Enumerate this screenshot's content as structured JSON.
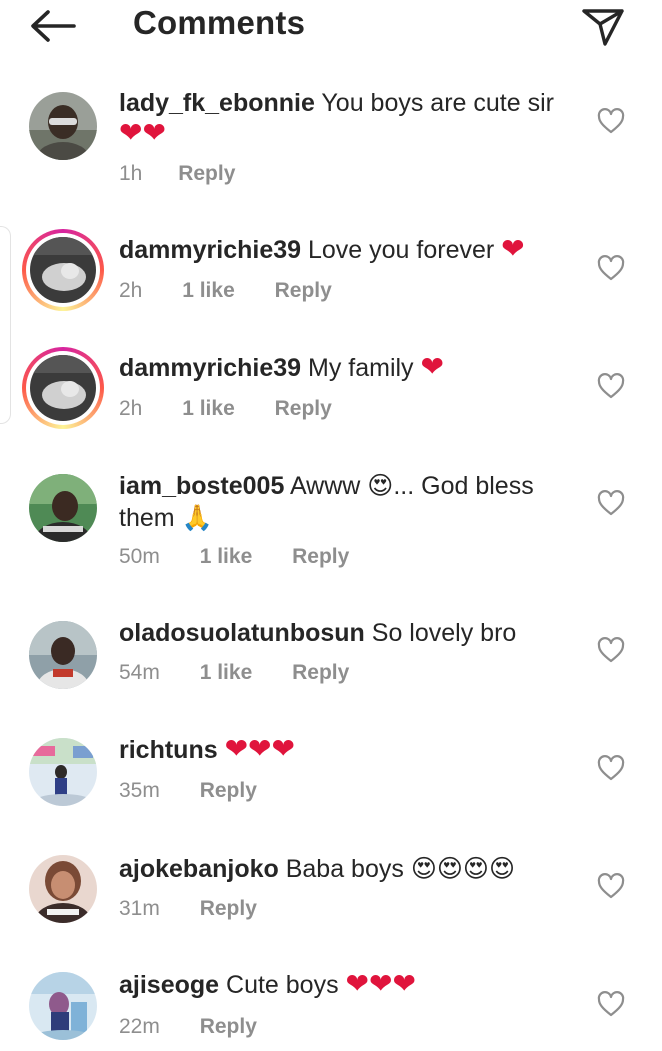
{
  "header": {
    "title": "Comments",
    "back_icon": "arrow-left-icon",
    "send_icon": "paper-plane-icon"
  },
  "colors": {
    "text": "#262626",
    "meta": "#8e8e8e",
    "heart": "#e0143c",
    "story_ring": "#d6249f"
  },
  "comments": [
    {
      "username": "lady_fk_ebonnie",
      "text": "You boys are cute sir",
      "emoji": "❤❤",
      "time": "1h",
      "likes": "",
      "reply": "Reply"
    },
    {
      "username": "dammyrichie39",
      "text": "Love you forever",
      "emoji": "❤",
      "time": "2h",
      "likes": "1 like",
      "reply": "Reply"
    },
    {
      "username": "dammyrichie39",
      "text": "My family",
      "emoji": "❤",
      "time": "2h",
      "likes": "1 like",
      "reply": "Reply"
    },
    {
      "username": "iam_boste005",
      "text": "Awww",
      "emoji": "😍",
      "text2": "... God bless them",
      "emoji2": "🙏",
      "time": "50m",
      "likes": "1 like",
      "reply": "Reply"
    },
    {
      "username": "oladosuolatunbosun",
      "text": "So lovely bro",
      "emoji": "",
      "time": "54m",
      "likes": "1 like",
      "reply": "Reply"
    },
    {
      "username": "richtuns",
      "text": "",
      "emoji": "❤❤❤",
      "time": "35m",
      "likes": "",
      "reply": "Reply"
    },
    {
      "username": "ajokebanjoko",
      "text": "Baba boys",
      "emoji": "😍😍😍😍",
      "time": "31m",
      "likes": "",
      "reply": "Reply"
    },
    {
      "username": "ajiseoge",
      "text": "Cute boys",
      "emoji": "❤❤❤",
      "time": "22m",
      "likes": "",
      "reply": "Reply"
    }
  ]
}
